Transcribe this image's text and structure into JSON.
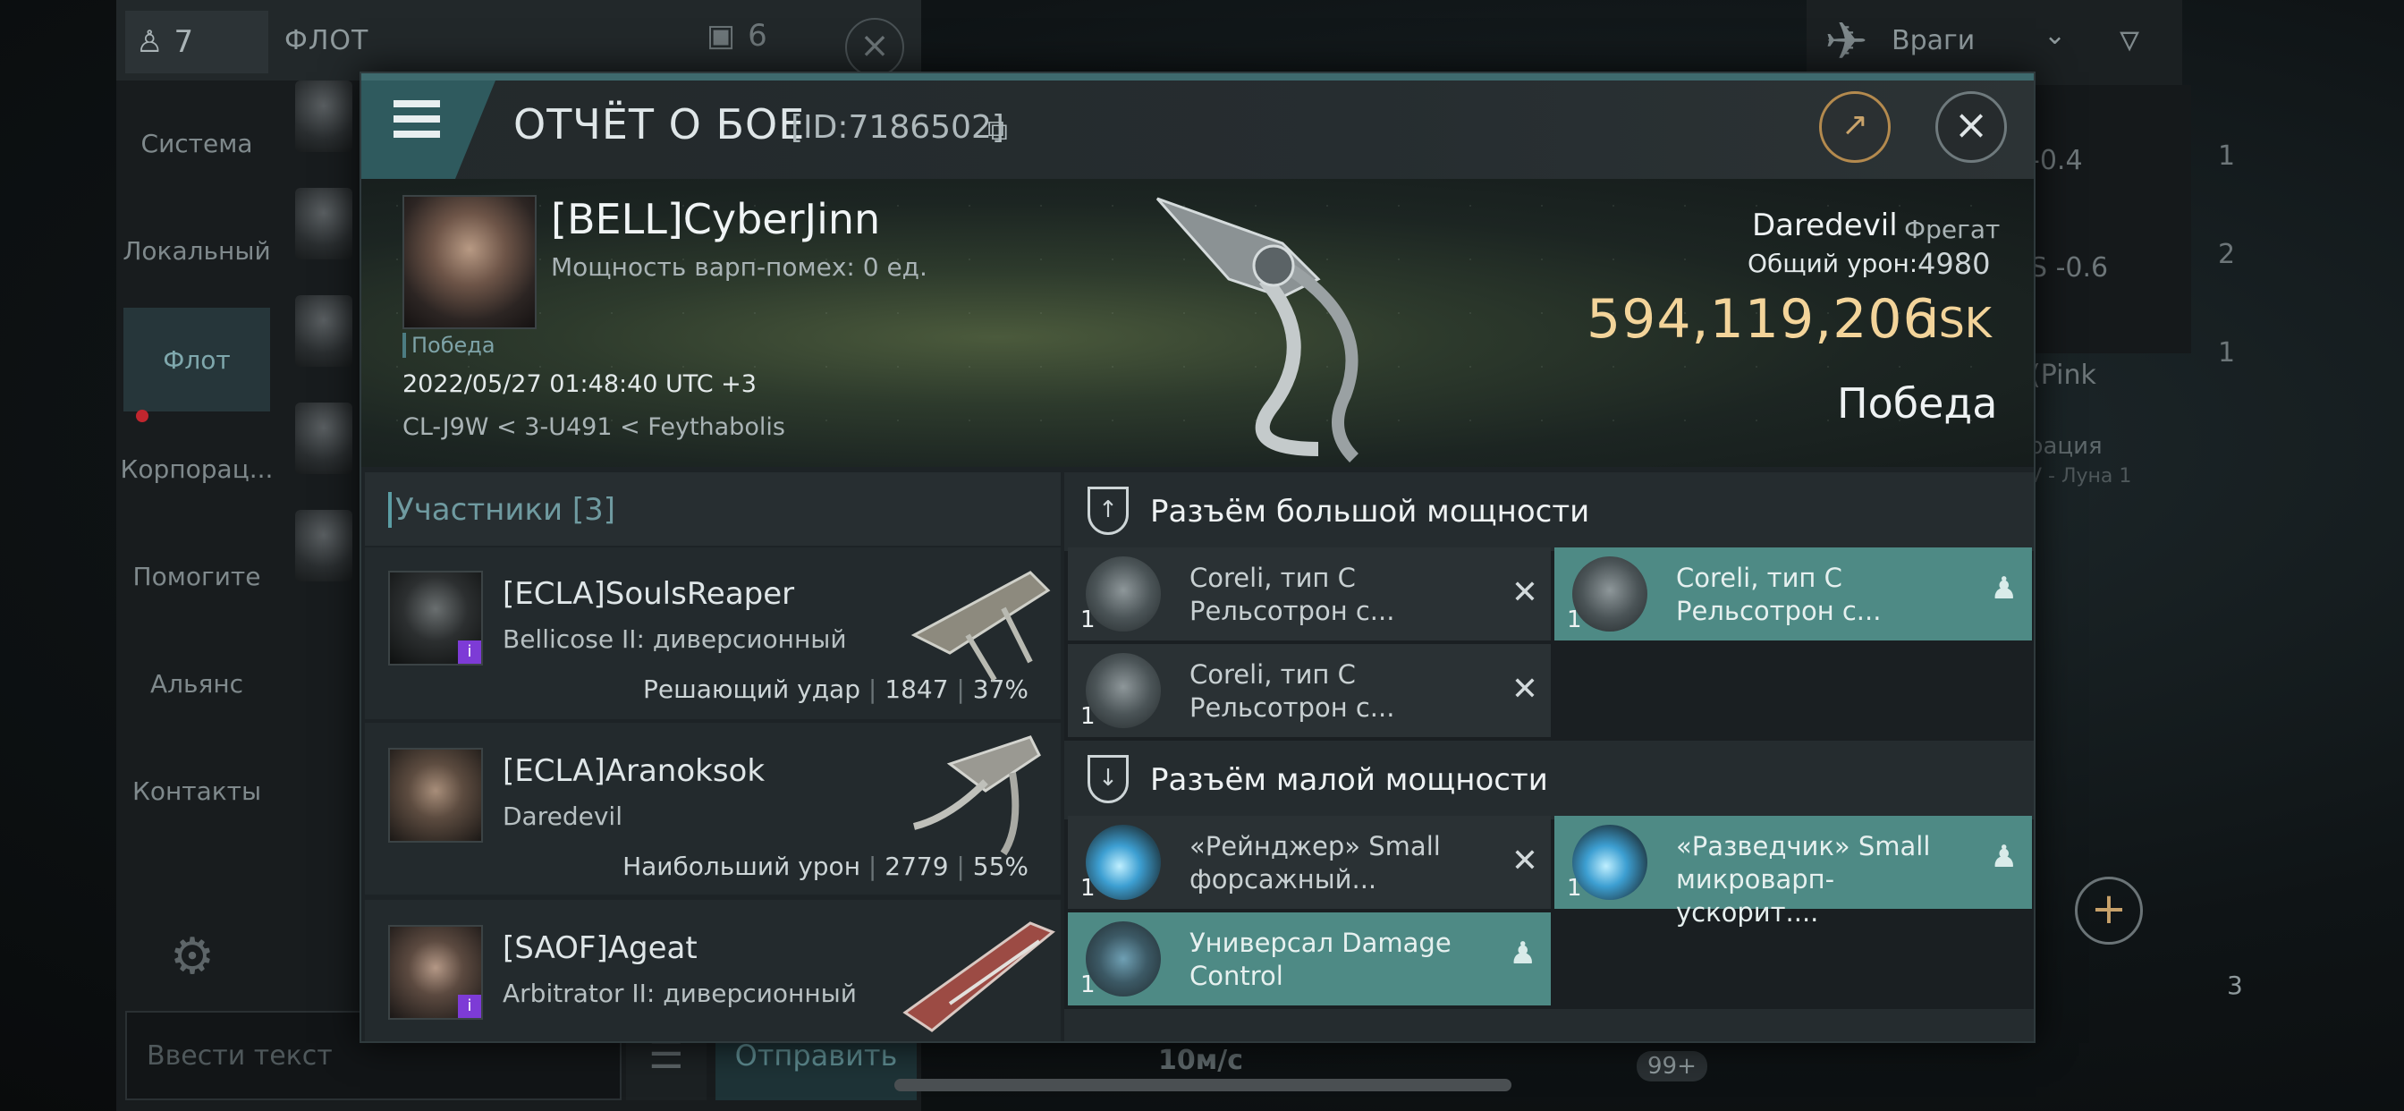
{
  "background": {
    "member_count": "7",
    "chat_title": "ФЛОТ",
    "chat_unread": "6",
    "side_tabs": [
      "Система",
      "Локальный",
      "Флот",
      "Корпорац...",
      "Помогите",
      "Альянс",
      "Контакты"
    ],
    "active_tab": "Флот",
    "chat_input_placeholder": "Ввести текст",
    "send_label": "Отправить",
    "enemy_filter": "Враги",
    "side_values": [
      "-0.4",
      "S -0.6",
      "(Pink"
    ],
    "right_counts": [
      "1",
      "2",
      "1"
    ],
    "location_note": "рация",
    "location_sub": "V - Луна 1",
    "speed": "10м/с",
    "badge": "99+",
    "turret_count": "3"
  },
  "modal": {
    "title": "ОТЧЁТ О БОЕ",
    "report_id": "[ID:7186502]",
    "pilot": {
      "name": "[BELL]CyberJinn",
      "warp_strength": "Мощность варп-помех: 0 ед.",
      "result": "Победа",
      "timestamp": "2022/05/27 01:48:40 UTC +3",
      "location": "CL-J9W < 3-U491 < Feythabolis"
    },
    "ship": {
      "name": "Daredevil",
      "class": "Фрегат",
      "damage_label": "Общий урон:",
      "damage_value": "4980",
      "isk_value": "594,119,206",
      "isk_unit": "ISK",
      "result": "Победа"
    },
    "participants": {
      "title": "Участники [3]",
      "items": [
        {
          "name": "[ECLA]SoulsReaper",
          "ship": "Bellicose II: диверсионный",
          "stat_label": "Решающий удар",
          "damage": "1847",
          "percent": "37%"
        },
        {
          "name": "[ECLA]Aranoksok",
          "ship": "Daredevil",
          "stat_label": "Наибольший урон",
          "damage": "2779",
          "percent": "55%"
        },
        {
          "name": "[SAOF]Ageat",
          "ship": "Arbitrator II: диверсионный",
          "stat_label": "",
          "damage": "",
          "percent": ""
        }
      ]
    },
    "high_slots": {
      "title": "Разъём большой мощности",
      "modules": [
        {
          "qty": "1",
          "name": "Coreli, тип C Рельсотрон с...",
          "status": "destroyed"
        },
        {
          "qty": "1",
          "name": "Coreli, тип C Рельсотрон с...",
          "status": "dropped"
        },
        {
          "qty": "1",
          "name": "Coreli, тип C Рельсотрон с...",
          "status": "destroyed"
        }
      ]
    },
    "low_slots": {
      "title": "Разъём малой мощности",
      "modules": [
        {
          "qty": "1",
          "name": "«Рейнджер» Small форсажный...",
          "status": "destroyed"
        },
        {
          "qty": "1",
          "name": "«Разведчик» Small микроварп-ускорит....",
          "status": "dropped"
        },
        {
          "qty": "1",
          "name": "Универсал Damage Control",
          "status": "dropped"
        }
      ]
    }
  }
}
